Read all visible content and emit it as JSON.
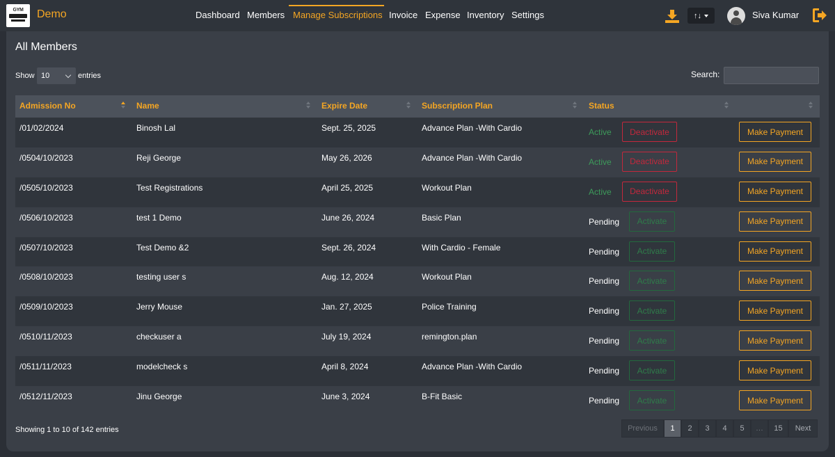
{
  "app": {
    "brand": "Demo",
    "logo_text": "GYM"
  },
  "nav": {
    "items": [
      {
        "label": "Dashboard",
        "active": false
      },
      {
        "label": "Members",
        "active": false
      },
      {
        "label": "Manage Subscriptions",
        "active": true
      },
      {
        "label": "Invoice",
        "active": false
      },
      {
        "label": "Expense",
        "active": false
      },
      {
        "label": "Inventory",
        "active": false
      },
      {
        "label": "Settings",
        "active": false
      }
    ]
  },
  "header": {
    "download_icon": "download-icon",
    "sort_toggle_label": "↑↓",
    "user_name": "Siva Kumar",
    "logout_icon": "logout-icon"
  },
  "page": {
    "title": "All Members",
    "show_label": "Show",
    "entries_value": "10",
    "entries_label": "entries",
    "search_label": "Search:",
    "search_value": ""
  },
  "table": {
    "columns": [
      "Admission No",
      "Name",
      "Expire Date",
      "Subscription Plan",
      "Status",
      ""
    ],
    "rows": [
      {
        "admission_no": "/01/02/2024",
        "name": "Binosh Lal",
        "expire": "Sept. 25, 2025",
        "plan": "Advance Plan -With Cardio",
        "status": "Active",
        "action": "Deactivate",
        "payment": "Make Payment"
      },
      {
        "admission_no": "/0504/10/2023",
        "name": "Reji George",
        "expire": "May 26, 2026",
        "plan": "Advance Plan -With Cardio",
        "status": "Active",
        "action": "Deactivate",
        "payment": "Make Payment"
      },
      {
        "admission_no": "/0505/10/2023",
        "name": "Test Registrations",
        "expire": "April 25, 2025",
        "plan": "Workout Plan",
        "status": "Active",
        "action": "Deactivate",
        "payment": "Make Payment"
      },
      {
        "admission_no": "/0506/10/2023",
        "name": "test 1 Demo",
        "expire": "June 26, 2024",
        "plan": "Basic Plan",
        "status": "Pending",
        "action": "Activate",
        "payment": "Make Payment"
      },
      {
        "admission_no": "/0507/10/2023",
        "name": "Test Demo &2",
        "expire": "Sept. 26, 2024",
        "plan": "With Cardio - Female",
        "status": "Pending",
        "action": "Activate",
        "payment": "Make Payment"
      },
      {
        "admission_no": "/0508/10/2023",
        "name": "testing user s",
        "expire": "Aug. 12, 2024",
        "plan": "Workout Plan",
        "status": "Pending",
        "action": "Activate",
        "payment": "Make Payment"
      },
      {
        "admission_no": "/0509/10/2023",
        "name": "Jerry Mouse",
        "expire": "Jan. 27, 2025",
        "plan": "Police Training",
        "status": "Pending",
        "action": "Activate",
        "payment": "Make Payment"
      },
      {
        "admission_no": "/0510/11/2023",
        "name": "checkuser a",
        "expire": "July 19, 2024",
        "plan": "remington.plan",
        "status": "Pending",
        "action": "Activate",
        "payment": "Make Payment"
      },
      {
        "admission_no": "/0511/11/2023",
        "name": "modelcheck s",
        "expire": "April 8, 2024",
        "plan": "Advance Plan -With Cardio",
        "status": "Pending",
        "action": "Activate",
        "payment": "Make Payment"
      },
      {
        "admission_no": "/0512/11/2023",
        "name": "Jinu George",
        "expire": "June 3, 2024",
        "plan": "B-Fit Basic",
        "status": "Pending",
        "action": "Activate",
        "payment": "Make Payment"
      }
    ]
  },
  "footer": {
    "info": "Showing 1 to 10 of 142 entries",
    "pages": [
      "Previous",
      "1",
      "2",
      "3",
      "4",
      "5",
      "…",
      "15",
      "Next"
    ],
    "current_page": "1"
  },
  "colors": {
    "accent": "#f5a623",
    "active_status": "#3d9a5a",
    "deactivate": "#c4283c",
    "activate": "#2f7d4a",
    "background": "#2b2f36",
    "card": "#3a3f47"
  }
}
